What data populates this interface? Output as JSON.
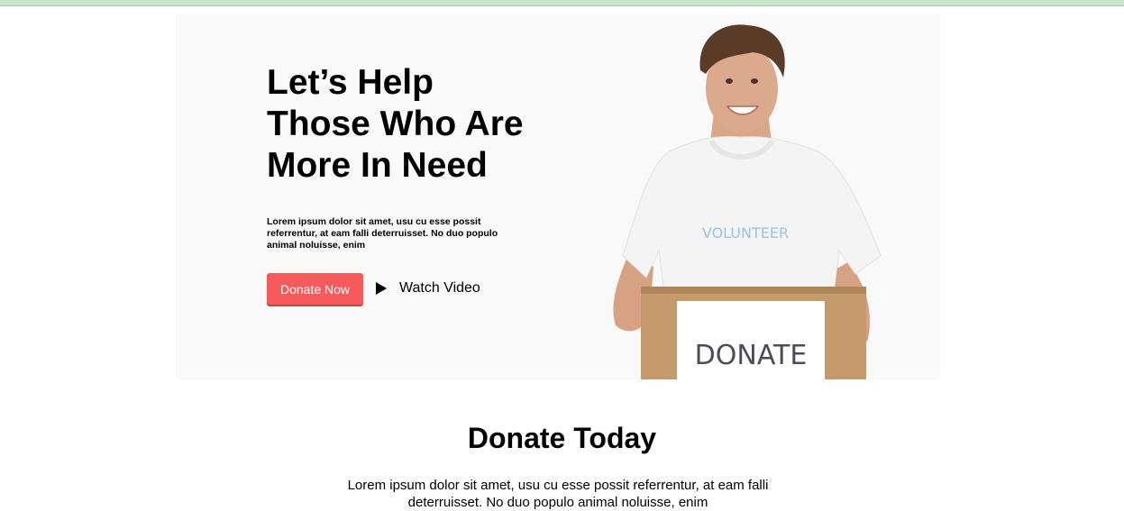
{
  "hero": {
    "title": "Let’s Help\nThose Who Are\nMore In Need",
    "text": "Lorem ipsum dolor sit amet, usu cu esse possit referrentur, at eam falli deterruisset. No duo populo animal noluisse, enim",
    "donate_label": "Donate Now",
    "watch_label": "Watch Video",
    "shirt_text": "VOLUNTEER",
    "box_sign": "DONATE"
  },
  "section": {
    "title": "Donate Today",
    "text": "Lorem ipsum dolor sit amet, usu cu esse possit referrentur, at eam falli deterruisset. No duo populo animal noluisse, enim"
  },
  "colors": {
    "top_strip": "#c8e6c9",
    "hero_bg": "#f9f9f9",
    "accent": "#f65a5a"
  },
  "icons": [
    "play-icon"
  ]
}
